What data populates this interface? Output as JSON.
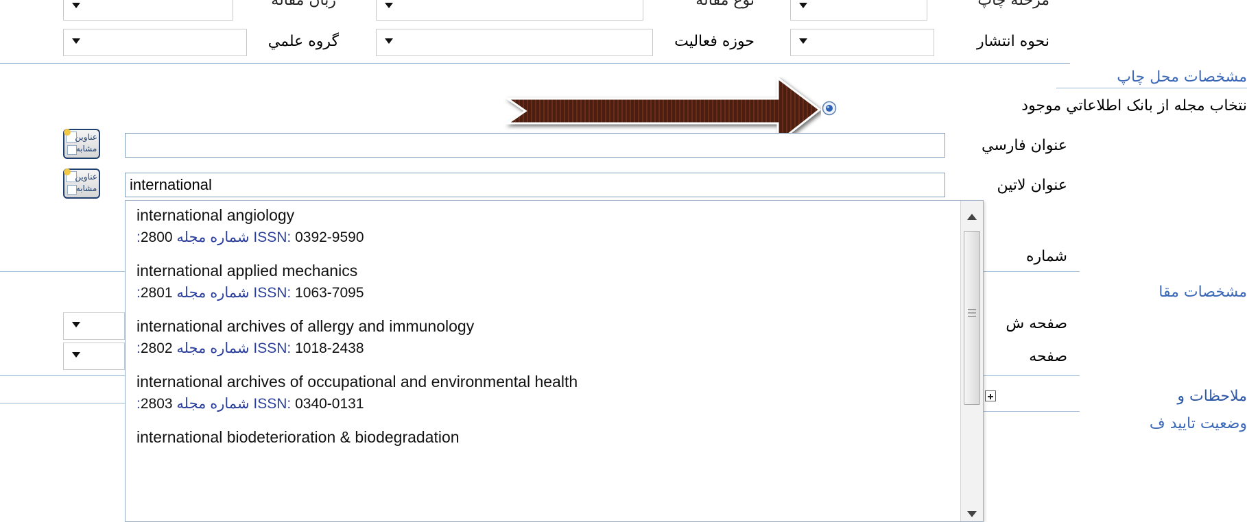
{
  "top_row_clipped": {
    "labels": [
      "زبان مقاله",
      "نوع مقاله",
      "مرحله چاپ"
    ]
  },
  "row2": {
    "group_label": "گروه علمي",
    "activity_label": "حوزه فعاليت",
    "publication_label": "نحوه انتشار"
  },
  "print_section": {
    "header": "مشخصات محل چاپ",
    "radio_label": "نتخاب مجله از بانک اطلاعاتي موجود"
  },
  "fields": {
    "persian_title_label": "عنوان فارسي",
    "persian_title_value": "",
    "latin_title_label": "عنوان لاتين",
    "latin_title_value": "international",
    "similar_button_label": "عناوين مشابه"
  },
  "partial_labels": {
    "number": "شماره",
    "article_section": "مشخصات مقا",
    "page_from": "صفحه ش",
    "page_to": "صفحه",
    "notes": "ملاحظات و",
    "approval_status": "وضعيت تاييد ف"
  },
  "autocomplete": {
    "items": [
      {
        "name": "international angiology",
        "num_label": ":شماره مجله",
        "num": "2800",
        "issn_label": "ISSN:",
        "issn": "0392-9590"
      },
      {
        "name": "international applied mechanics",
        "num_label": ":شماره مجله",
        "num": "2801",
        "issn_label": "ISSN:",
        "issn": "1063-7095"
      },
      {
        "name": "international archives of allergy and immunology",
        "num_label": ":شماره مجله",
        "num": "2802",
        "issn_label": "ISSN:",
        "issn": "1018-2438"
      },
      {
        "name": "international archives of occupational and environmental health",
        "num_label": ":شماره مجله",
        "num": "2803",
        "issn_label": "ISSN:",
        "issn": "0340-0131"
      },
      {
        "name": "international biodeterioration & biodegradation",
        "num_label": "",
        "num": "",
        "issn_label": "",
        "issn": ""
      }
    ]
  },
  "colors": {
    "section_text": "#3b68b8",
    "arrow_fill": "#4a1f12",
    "link_blue": "#2b3f9c"
  },
  "icons": {
    "dropdown": "triangle-down",
    "radio": "radio-selected",
    "expand": "plus-box",
    "annotation": "arrow-left"
  }
}
